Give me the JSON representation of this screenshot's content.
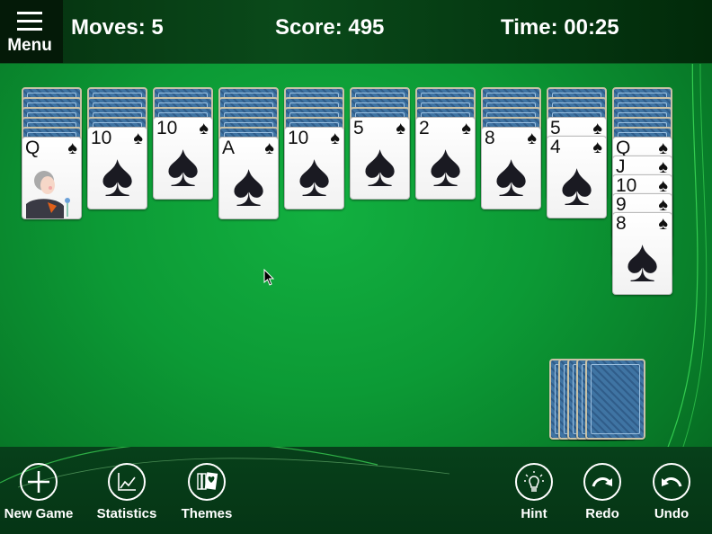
{
  "header": {
    "menu_label": "Menu",
    "moves": "Moves: 5",
    "score": "Score: 495",
    "time": "Time: 00:25"
  },
  "tableau": [
    {
      "face_down": 5,
      "face_up": [
        {
          "rank": "Q",
          "suit": "♠",
          "face_card": true
        }
      ]
    },
    {
      "face_down": 4,
      "face_up": [
        {
          "rank": "10",
          "suit": "♠"
        }
      ]
    },
    {
      "face_down": 3,
      "face_up": [
        {
          "rank": "10",
          "suit": "♠"
        }
      ]
    },
    {
      "face_down": 5,
      "face_up": [
        {
          "rank": "A",
          "suit": "♠"
        }
      ]
    },
    {
      "face_down": 4,
      "face_up": [
        {
          "rank": "10",
          "suit": "♠"
        }
      ]
    },
    {
      "face_down": 3,
      "face_up": [
        {
          "rank": "5",
          "suit": "♠"
        }
      ]
    },
    {
      "face_down": 3,
      "face_up": [
        {
          "rank": "2",
          "suit": "♠"
        }
      ]
    },
    {
      "face_down": 4,
      "face_up": [
        {
          "rank": "8",
          "suit": "♠"
        }
      ]
    },
    {
      "face_down": 3,
      "face_up": [
        {
          "rank": "5",
          "suit": "♠"
        },
        {
          "rank": "4",
          "suit": "♠"
        }
      ]
    },
    {
      "face_down": 5,
      "face_up": [
        {
          "rank": "Q",
          "suit": "♠"
        },
        {
          "rank": "J",
          "suit": "♠"
        },
        {
          "rank": "10",
          "suit": "♠"
        },
        {
          "rank": "9",
          "suit": "♠"
        },
        {
          "rank": "8",
          "suit": "♠"
        }
      ]
    }
  ],
  "stock": {
    "piles": 5
  },
  "toolbar": {
    "new_game": "New Game",
    "statistics": "Statistics",
    "themes": "Themes",
    "hint": "Hint",
    "redo": "Redo",
    "undo": "Undo"
  },
  "colors": {
    "felt": "#0c9a35",
    "card_back": "#3f74a3",
    "bar": "#053515"
  }
}
